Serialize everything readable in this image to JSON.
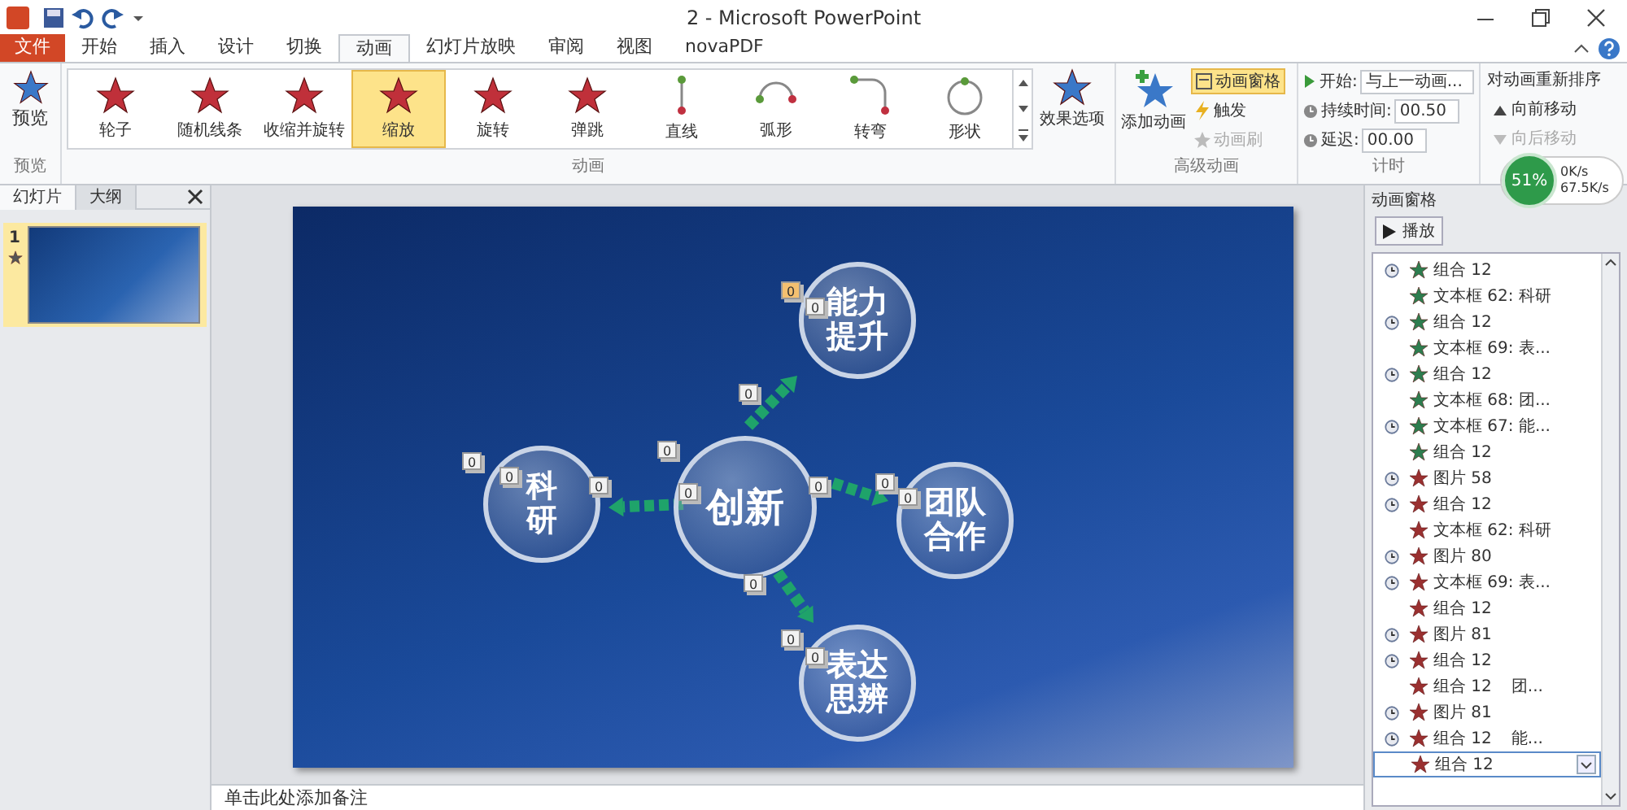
{
  "window": {
    "title": "2 - Microsoft PowerPoint"
  },
  "ribbon_tabs": [
    {
      "label": "文件",
      "kind": "file",
      "selected": false
    },
    {
      "label": "开始",
      "kind": "tab",
      "selected": false
    },
    {
      "label": "插入",
      "kind": "tab",
      "selected": false
    },
    {
      "label": "设计",
      "kind": "tab",
      "selected": false
    },
    {
      "label": "切换",
      "kind": "tab",
      "selected": false
    },
    {
      "label": "动画",
      "kind": "tab",
      "selected": true
    },
    {
      "label": "幻灯片放映",
      "kind": "tab",
      "selected": false
    },
    {
      "label": "审阅",
      "kind": "tab",
      "selected": false
    },
    {
      "label": "视图",
      "kind": "tab",
      "selected": false
    },
    {
      "label": "novaPDF",
      "kind": "tab",
      "selected": false
    }
  ],
  "ribbon": {
    "preview": {
      "button": "预览",
      "group_label": "预览"
    },
    "animation_gallery": {
      "items": [
        {
          "label": "轮子",
          "kind": "star",
          "selected": false
        },
        {
          "label": "随机线条",
          "kind": "star",
          "selected": false
        },
        {
          "label": "收缩并旋转",
          "kind": "star",
          "selected": false
        },
        {
          "label": "缩放",
          "kind": "star",
          "selected": true
        },
        {
          "label": "旋转",
          "kind": "star",
          "selected": false
        },
        {
          "label": "弹跳",
          "kind": "star",
          "selected": false
        },
        {
          "label": "直线",
          "kind": "line",
          "selected": false
        },
        {
          "label": "弧形",
          "kind": "arc",
          "selected": false
        },
        {
          "label": "转弯",
          "kind": "turn",
          "selected": false
        },
        {
          "label": "形状",
          "kind": "shape",
          "selected": false
        }
      ],
      "effect_options": "效果选项",
      "group_label": "动画"
    },
    "advanced": {
      "add_animation": "添加动画",
      "animation_pane": {
        "label": "动画窗格",
        "on": true
      },
      "trigger": "触发",
      "painter": {
        "label": "动画刷",
        "disabled": true
      },
      "group_label": "高级动画"
    },
    "timing": {
      "start": {
        "label": "开始:",
        "value": "与上一动画..."
      },
      "duration": {
        "label": "持续时间:",
        "value": "00.50"
      },
      "delay": {
        "label": "延迟:",
        "value": "00.00"
      },
      "group_label": "计时"
    },
    "reorder": {
      "title": "对动画重新排序",
      "actions": [
        {
          "label": "向前移动",
          "disabled": false
        },
        {
          "label": "向后移动",
          "disabled": true
        }
      ]
    }
  },
  "network_widget": {
    "percent": "51%",
    "up": "0K/s",
    "down": "67.5K/s"
  },
  "slides_pane": {
    "tabs": [
      {
        "label": "幻灯片",
        "selected": true
      },
      {
        "label": "大纲",
        "selected": false
      }
    ],
    "slides": [
      {
        "number": "1",
        "selected": true
      }
    ]
  },
  "slide": {
    "nodes": [
      {
        "lines": [
          "创新"
        ],
        "kind": "center"
      },
      {
        "lines": [
          "能力",
          "提升"
        ],
        "kind": "outer"
      },
      {
        "lines": [
          "科",
          "研"
        ],
        "kind": "outer"
      },
      {
        "lines": [
          "团队",
          "合作"
        ],
        "kind": "outer"
      },
      {
        "lines": [
          "表达",
          "思辨"
        ],
        "kind": "outer"
      }
    ],
    "tags": [
      {
        "text": "0",
        "highlighted": true
      },
      {
        "text": "0",
        "highlighted": false
      },
      {
        "text": "0",
        "highlighted": false
      },
      {
        "text": "0",
        "highlighted": false
      },
      {
        "text": "0",
        "highlighted": false
      },
      {
        "text": "0",
        "highlighted": false
      },
      {
        "text": "0",
        "highlighted": false
      },
      {
        "text": "0",
        "highlighted": false
      },
      {
        "text": "0",
        "highlighted": false
      },
      {
        "text": "0",
        "highlighted": false
      },
      {
        "text": "0",
        "highlighted": false
      },
      {
        "text": "0",
        "highlighted": false
      },
      {
        "text": "0",
        "highlighted": false
      },
      {
        "text": "0",
        "highlighted": false
      }
    ]
  },
  "notes": {
    "text": "单击此处添加备注"
  },
  "animation_pane": {
    "title": "动画窗格",
    "play": "播放",
    "items": [
      {
        "label": "组合 12",
        "kind": "entrance",
        "clock": true,
        "selected": false
      },
      {
        "label": "文本框 62: 科研",
        "kind": "entrance",
        "clock": false,
        "selected": false
      },
      {
        "label": "组合 12",
        "kind": "entrance",
        "clock": true,
        "selected": false
      },
      {
        "label": "文本框 69: 表...",
        "kind": "entrance",
        "clock": false,
        "selected": false
      },
      {
        "label": "组合 12",
        "kind": "entrance",
        "clock": true,
        "selected": false
      },
      {
        "label": "文本框 68: 团...",
        "kind": "entrance",
        "clock": false,
        "selected": false
      },
      {
        "label": "文本框 67: 能...",
        "kind": "entrance",
        "clock": true,
        "selected": false
      },
      {
        "label": "组合 12",
        "kind": "entrance",
        "clock": false,
        "selected": false
      },
      {
        "label": "图片 58",
        "kind": "exit",
        "clock": true,
        "selected": false
      },
      {
        "label": "组合 12",
        "kind": "exit",
        "clock": true,
        "selected": false
      },
      {
        "label": "文本框 62: 科研",
        "kind": "exit",
        "clock": false,
        "selected": false
      },
      {
        "label": "图片 80",
        "kind": "exit",
        "clock": true,
        "selected": false
      },
      {
        "label": "文本框 69: 表...",
        "kind": "exit",
        "clock": true,
        "selected": false
      },
      {
        "label": "组合 12",
        "kind": "exit",
        "clock": false,
        "selected": false
      },
      {
        "label": "图片 81",
        "kind": "exit",
        "clock": true,
        "selected": false
      },
      {
        "label": "组合 12",
        "kind": "exit",
        "clock": true,
        "selected": false
      },
      {
        "label": "组合 12",
        "kind": "exit",
        "clock": false,
        "selected": false,
        "extra": "团..."
      },
      {
        "label": "图片 81",
        "kind": "exit",
        "clock": true,
        "selected": false
      },
      {
        "label": "组合 12",
        "kind": "exit",
        "clock": true,
        "selected": false,
        "extra": "能..."
      },
      {
        "label": "组合 12",
        "kind": "exit",
        "clock": false,
        "selected": true
      }
    ]
  }
}
